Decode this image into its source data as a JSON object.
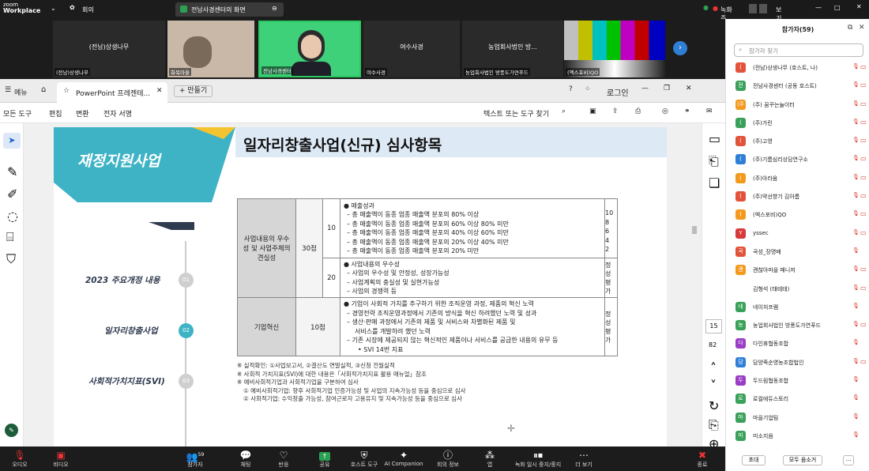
{
  "zoom": {
    "brand1": "zoom",
    "brand2": "Workplace",
    "meeting_label": "회의",
    "share_title": "전남사경센터의 화면",
    "rec_label": "녹화 중...",
    "view_label": "보기"
  },
  "videos": [
    {
      "name": "(전남)상생나무",
      "label": "(전남)상생나무"
    },
    {
      "name": "",
      "label": "화목마을"
    },
    {
      "name": "",
      "label": "전남사경센터"
    },
    {
      "name": "여수사경",
      "label": "여수사경"
    },
    {
      "name": "농업회사법인 방...",
      "label": "농업회사법인 방풍도가연푸드"
    },
    {
      "name": "",
      "label": "(엑스포비)QO"
    }
  ],
  "browser": {
    "menu_label": "메뉴",
    "tab_title": "PowerPoint 프레젠테...",
    "new_tab": "+ 만들기",
    "login": "로그인",
    "tools": [
      "모든 도구",
      "편집",
      "변환",
      "전자 서명"
    ],
    "find_placeholder": "텍스트 또는 도구 찾기",
    "page_num": "15",
    "total_pages": "82"
  },
  "slide": {
    "side_title": "재정지원사업",
    "title": "일자리창출사업(신규) 심사항목",
    "nav": [
      {
        "label": "2023 주요개정 내용",
        "num": "01"
      },
      {
        "label": "일자리창출사업",
        "num": "02"
      },
      {
        "label": "사회적가치지표(SVI)",
        "num": "03"
      }
    ],
    "row1_label": "사업내용의 우수성 및 사업주체의 견실성",
    "row1_pts": "30점",
    "r1a_pts": "10",
    "r1a_lines": [
      "● 매출성과",
      "– 총 매출액이 동종 업종 매출액 분포의 80% 이상",
      "– 총 매출액이 동종 업종 매출액 분포의 60% 이상 80% 미만",
      "– 총 매출액이 동종 업종 매출액 분포의 40% 이상 60% 미만",
      "– 총 매출액이 동종 업종 매출액 분포의 20% 이상 40% 미만",
      "– 총 매출액이 동종 업종 매출액 분포의 20% 미만"
    ],
    "r1a_scores": [
      "10",
      "8",
      "6",
      "4",
      "2"
    ],
    "r1b_pts": "20",
    "r1b_lines": [
      "● 사업내용의 우수성",
      "– 사업의 우수성 및 안정성, 성장가능성",
      "– 사업계획의 충실성 및 실현가능성",
      "– 사업의 경쟁력 등"
    ],
    "r1b_side": [
      "정",
      "성",
      "평",
      "가"
    ],
    "row2_label": "기업혁신",
    "row2_pts": "10점",
    "r2_lines": [
      "● 기업이 사회적 가치를 추구하기 위한 조직운영 과정, 제품의 혁신 노력",
      "– 경영전략 조직운영과정에서 기존의 방식을 혁신 하려했던 노력 및 성과",
      "– 생산·판매 과정에서 기존의 제품 및 서비스와 차별화된 제품 및",
      "서비스를 개발하려 했던 노력",
      "– 기존 시장에 제공되지 않는 혁신적인 제품이나 서비스를 공급한 내용의 유무 등",
      "• SVI 14번 지표"
    ],
    "r2_side": [
      "정",
      "성",
      "평",
      "가"
    ],
    "notes": [
      "※ 실적확인: ①사업보고서, ②결산도 연말실적, ③신청 전월실적",
      "※ 사회적 가치지표(SVI)에 대한 내용은「사회적가치지표 활용 매뉴얼」참조",
      "※ 예비사회적기업과 사회적기업을 구분하여 심사",
      "① 예비사회적기업: 향후 사회적기업 인증가능성 및 사업의 지속가능성 등을 중심으로 심사",
      "② 사회적기업: 수익창출 가능성, 참여근로자 고용유지 및 지속가능성 등을 중심으로 심사"
    ]
  },
  "bottom": [
    "오디오",
    "비디오",
    "참가자",
    "채팅",
    "반응",
    "공유",
    "호스트 도구",
    "AI Companion",
    "회의 정보",
    "앱",
    "녹화 일시 중지/중지",
    "더 보기",
    "종료"
  ],
  "participants_count": "59",
  "panel": {
    "title": "참가자(59)",
    "search_placeholder": "참가자 찾기",
    "invite": "초대",
    "mute_all": "모두 음소거",
    "more": "...",
    "list": [
      {
        "name": "(전남)상생나무 (호스트, 나)",
        "initial": "(",
        "color": "#e2533b"
      },
      {
        "name": "전남사경센터 (공동 호스트)",
        "initial": "전",
        "color": "#3aa15a"
      },
      {
        "name": "(주) 꿈꾸는놀이터",
        "initial": "(주",
        "color": "#f39a1e"
      },
      {
        "name": "(주)가린",
        "initial": "(",
        "color": "#3aa15a"
      },
      {
        "name": "(주)고영",
        "initial": "(",
        "color": "#e2533b"
      },
      {
        "name": "(주)기름심리상담연구소",
        "initial": "(",
        "color": "#2f7fd6"
      },
      {
        "name": "(주)아라움",
        "initial": "(",
        "color": "#f39a1e"
      },
      {
        "name": "(주)약선향기 김아름",
        "initial": "(",
        "color": "#e2533b"
      },
      {
        "name": "(엑스포비)QO",
        "initial": "(",
        "color": "#f39a1e"
      },
      {
        "name": "yssec",
        "initial": "Y",
        "color": "#d63a3a"
      },
      {
        "name": "곡성_장명배",
        "initial": "곡",
        "color": "#e2533b"
      },
      {
        "name": "괜찮아마을 매니저",
        "initial": "괜",
        "color": "#f39a1e"
      },
      {
        "name": "김형석 (태테테)",
        "initial": "",
        "color": "#ffffff"
      },
      {
        "name": "네이처프렘",
        "initial": "네",
        "color": "#3aa15a"
      },
      {
        "name": "농업회사법인 방풍도가연푸드",
        "initial": "농",
        "color": "#3aa15a"
      },
      {
        "name": "다인휴협동조합",
        "initial": "다",
        "color": "#9a3cc4"
      },
      {
        "name": "담양죽순영농조합법인",
        "initial": "담",
        "color": "#2f7fd6"
      },
      {
        "name": "두드림협동조합",
        "initial": "두",
        "color": "#9a3cc4"
      },
      {
        "name": "로컬에듀스토리",
        "initial": "로",
        "color": "#3aa15a"
      },
      {
        "name": "마을기업팀",
        "initial": "마",
        "color": "#3aa15a"
      },
      {
        "name": "미소지음",
        "initial": "미",
        "color": "#3aa15a"
      }
    ]
  }
}
